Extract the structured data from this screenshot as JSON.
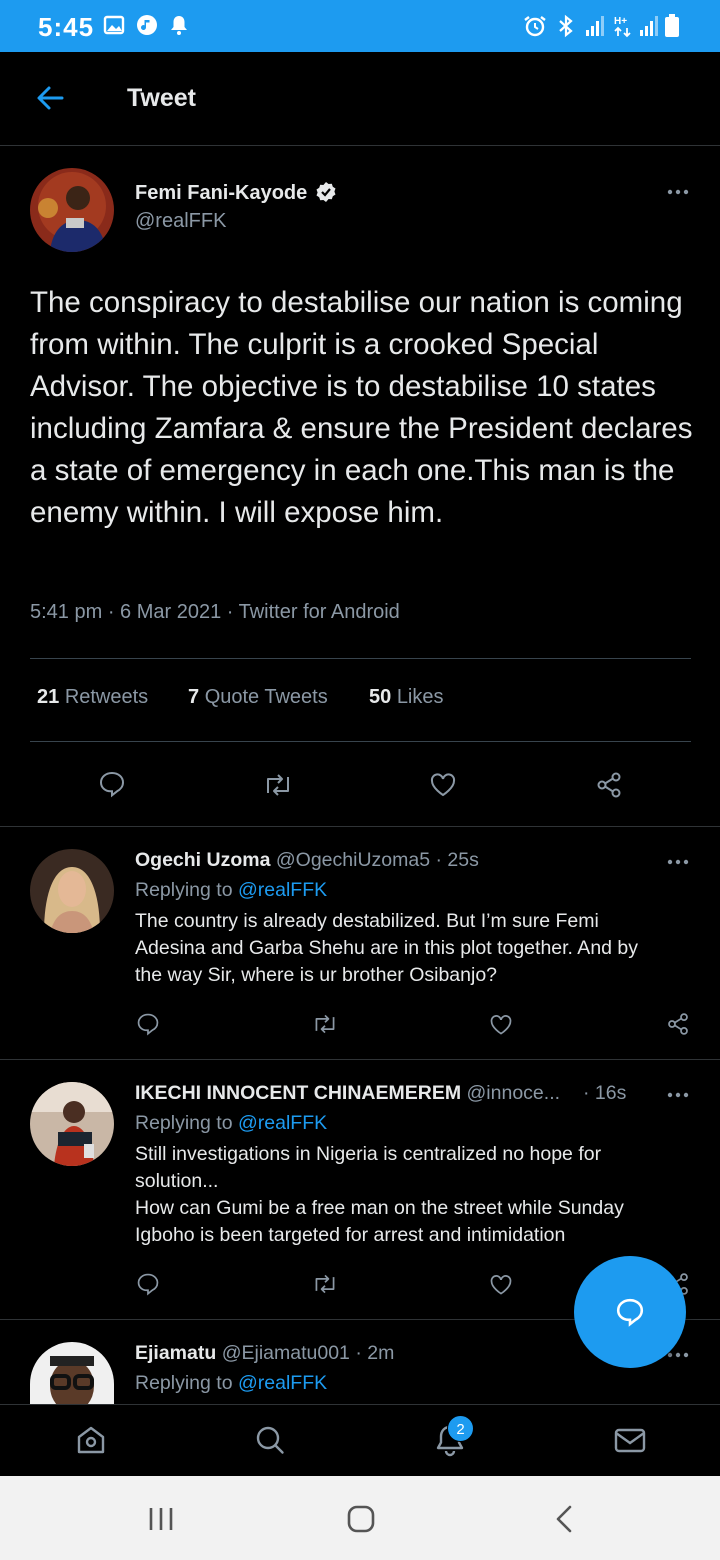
{
  "status_bar": {
    "time": "5:45"
  },
  "header": {
    "title": "Tweet"
  },
  "main_tweet": {
    "author_name": "Femi Fani-Kayode",
    "author_handle": "@realFFK",
    "text": "The conspiracy to destabilise our nation is coming from within. The culprit is a crooked Special Advisor. The objective is to destabilise 10 states including Zamfara & ensure the President declares a state of emergency in each one.This man is the enemy within. I will expose him.",
    "timestamp": "5:41 pm · 6 Mar 2021 · Twitter for Android",
    "retweets_count": "21",
    "retweets_label": "Retweets",
    "quote_count": "7",
    "quote_label": "Quote Tweets",
    "likes_count": "50",
    "likes_label": "Likes"
  },
  "replies": [
    {
      "name": "Ogechi Uzoma",
      "handle_time": "@OgechiUzoma5 · 25s",
      "replying_prefix": "Replying to",
      "replying_to": "@realFFK",
      "lines": [
        "The country is already destabilized. But I’m sure Femi",
        "Adesina and Garba Shehu are in this plot together. And by",
        "the way Sir, where is ur brother Osibanjo?"
      ]
    },
    {
      "name": "IKECHI INNOCENT CHINAEMEREM",
      "handle": "@innoce...",
      "time": "· 16s",
      "replying_prefix": "Replying to",
      "replying_to": "@realFFK",
      "lines": [
        "Still investigations in Nigeria is centralized no hope for",
        "solution...",
        "How can Gumi be a free man on the street while Sunday",
        "Igboho is been targeted for arrest and intimidation"
      ]
    },
    {
      "name": "Ejiamatu",
      "handle_time": "@Ejiamatu001 · 2m",
      "replying_prefix": "Replying to",
      "replying_to": "@realFFK"
    }
  ],
  "tab_bar": {
    "notifications_badge": "2"
  },
  "colors": {
    "accent": "#1d9bf0",
    "background": "#000000",
    "muted": "#8b98a5"
  }
}
